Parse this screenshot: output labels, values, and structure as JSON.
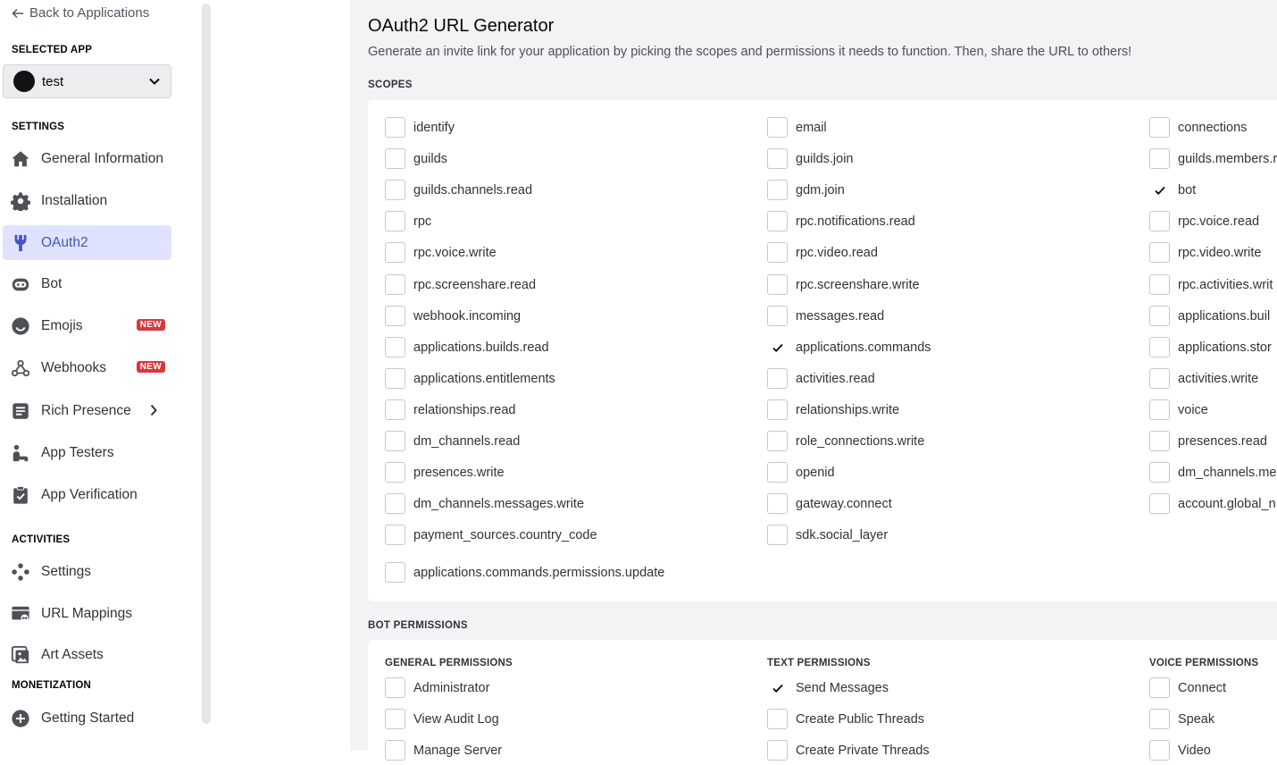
{
  "sidebar": {
    "back_label": "Back to Applications",
    "selected_app_label": "SELECTED APP",
    "selected_app_name": "test",
    "settings_label": "SETTINGS",
    "activities_label": "ACTIVITIES",
    "monetization_label": "MONETIZATION",
    "items": [
      {
        "label": "General Information"
      },
      {
        "label": "Installation"
      },
      {
        "label": "OAuth2"
      },
      {
        "label": "Bot"
      },
      {
        "label": "Emojis",
        "badge": "NEW"
      },
      {
        "label": "Webhooks",
        "badge": "NEW"
      },
      {
        "label": "Rich Presence"
      },
      {
        "label": "App Testers"
      },
      {
        "label": "App Verification"
      },
      {
        "label": "Settings"
      },
      {
        "label": "URL Mappings"
      },
      {
        "label": "Art Assets"
      },
      {
        "label": "Getting Started"
      }
    ]
  },
  "main": {
    "title": "OAuth2 URL Generator",
    "description": "Generate an invite link for your application by picking the scopes and permissions it needs to function. Then, share the URL to others!",
    "scopes_label": "SCOPES",
    "bot_permissions_label": "BOT PERMISSIONS",
    "scopes": {
      "col1": [
        {
          "label": "identify",
          "checked": false
        },
        {
          "label": "guilds",
          "checked": false
        },
        {
          "label": "guilds.channels.read",
          "checked": false
        },
        {
          "label": "rpc",
          "checked": false
        },
        {
          "label": "rpc.voice.write",
          "checked": false
        },
        {
          "label": "rpc.screenshare.read",
          "checked": false
        },
        {
          "label": "webhook.incoming",
          "checked": false
        },
        {
          "label": "applications.builds.read",
          "checked": false
        },
        {
          "label": "applications.entitlements",
          "checked": false
        },
        {
          "label": "relationships.read",
          "checked": false
        },
        {
          "label": "dm_channels.read",
          "checked": false
        },
        {
          "label": "presences.write",
          "checked": false
        },
        {
          "label": "dm_channels.messages.write",
          "checked": false
        },
        {
          "label": "payment_sources.country_code",
          "checked": false
        }
      ],
      "col2": [
        {
          "label": "email",
          "checked": false
        },
        {
          "label": "guilds.join",
          "checked": false
        },
        {
          "label": "gdm.join",
          "checked": false
        },
        {
          "label": "rpc.notifications.read",
          "checked": false
        },
        {
          "label": "rpc.video.read",
          "checked": false
        },
        {
          "label": "rpc.screenshare.write",
          "checked": false
        },
        {
          "label": "messages.read",
          "checked": false
        },
        {
          "label": "applications.commands",
          "checked": true
        },
        {
          "label": "activities.read",
          "checked": false
        },
        {
          "label": "relationships.write",
          "checked": false
        },
        {
          "label": "role_connections.write",
          "checked": false
        },
        {
          "label": "openid",
          "checked": false
        },
        {
          "label": "gateway.connect",
          "checked": false
        },
        {
          "label": "sdk.social_layer",
          "checked": false
        }
      ],
      "col3": [
        {
          "label": "connections",
          "checked": false
        },
        {
          "label": "guilds.members.r",
          "checked": false
        },
        {
          "label": "bot",
          "checked": true
        },
        {
          "label": "rpc.voice.read",
          "checked": false
        },
        {
          "label": "rpc.video.write",
          "checked": false
        },
        {
          "label": "rpc.activities.writ",
          "checked": false
        },
        {
          "label": "applications.buil",
          "checked": false
        },
        {
          "label": "applications.stor",
          "checked": false
        },
        {
          "label": "activities.write",
          "checked": false
        },
        {
          "label": "voice",
          "checked": false
        },
        {
          "label": "presences.read",
          "checked": false
        },
        {
          "label": "dm_channels.me",
          "checked": false
        },
        {
          "label": "account.global_n",
          "checked": false
        }
      ],
      "extra": {
        "label": "applications.commands.permissions.update",
        "checked": false
      }
    },
    "permissions": {
      "general": {
        "heading": "GENERAL PERMISSIONS",
        "items": [
          {
            "label": "Administrator",
            "checked": false
          },
          {
            "label": "View Audit Log",
            "checked": false
          },
          {
            "label": "Manage Server",
            "checked": false
          }
        ]
      },
      "text": {
        "heading": "TEXT PERMISSIONS",
        "items": [
          {
            "label": "Send Messages",
            "checked": true
          },
          {
            "label": "Create Public Threads",
            "checked": false
          },
          {
            "label": "Create Private Threads",
            "checked": false
          }
        ]
      },
      "voice": {
        "heading": "VOICE PERMISSIONS",
        "items": [
          {
            "label": "Connect",
            "checked": false
          },
          {
            "label": "Speak",
            "checked": false
          },
          {
            "label": "Video",
            "checked": false
          }
        ]
      }
    }
  },
  "colors": {
    "accent": "#4752c4",
    "active_bg": "#e0e3ff",
    "badge": "#da373c",
    "content_bg": "#f2f3f5"
  }
}
